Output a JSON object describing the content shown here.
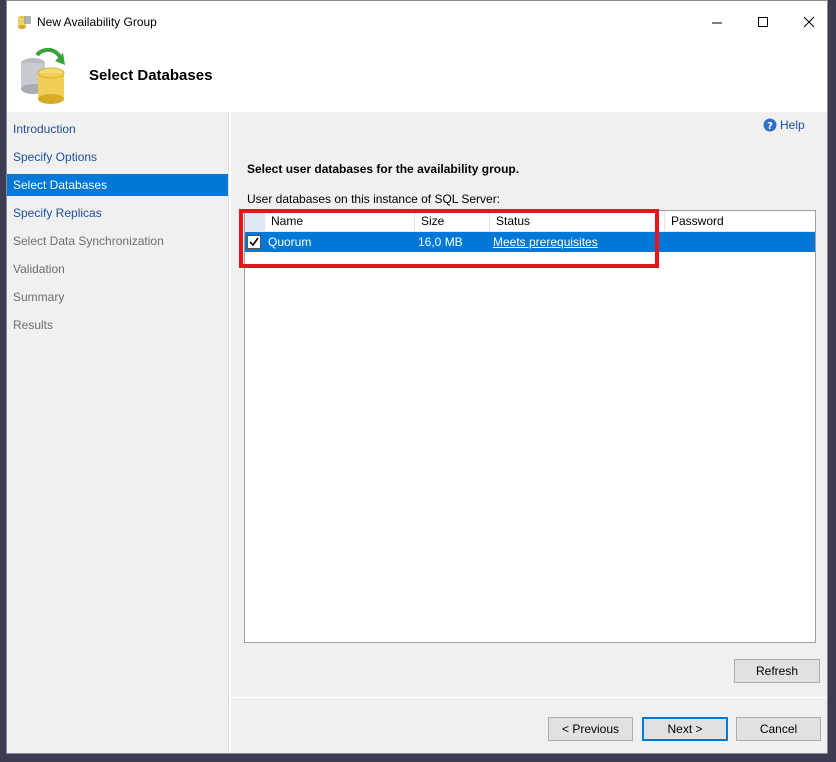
{
  "window": {
    "title": "New Availability Group"
  },
  "header": {
    "title": "Select Databases"
  },
  "sidebar": {
    "items": [
      {
        "label": "Introduction",
        "state": "link"
      },
      {
        "label": "Specify Options",
        "state": "link"
      },
      {
        "label": "Select Databases",
        "state": "active"
      },
      {
        "label": "Specify Replicas",
        "state": "link"
      },
      {
        "label": "Select Data Synchronization",
        "state": "disabled"
      },
      {
        "label": "Validation",
        "state": "disabled"
      },
      {
        "label": "Summary",
        "state": "disabled"
      },
      {
        "label": "Results",
        "state": "disabled"
      }
    ]
  },
  "main": {
    "help_label": "Help",
    "instruction": "Select user databases for the availability group.",
    "list_label": "User databases on this instance of SQL Server:",
    "columns": {
      "name": "Name",
      "size": "Size",
      "status": "Status",
      "password": "Password"
    },
    "rows": [
      {
        "name": "Quorum",
        "size": "16,0 MB",
        "status": "Meets prerequisites",
        "password": "",
        "checked": true
      }
    ],
    "refresh_label": "Refresh"
  },
  "footer": {
    "previous_label": "< Previous",
    "next_label": "Next >",
    "cancel_label": "Cancel"
  },
  "colors": {
    "selection": "#0078d7",
    "link": "#1f4e99",
    "highlight_box": "#e8141b"
  }
}
